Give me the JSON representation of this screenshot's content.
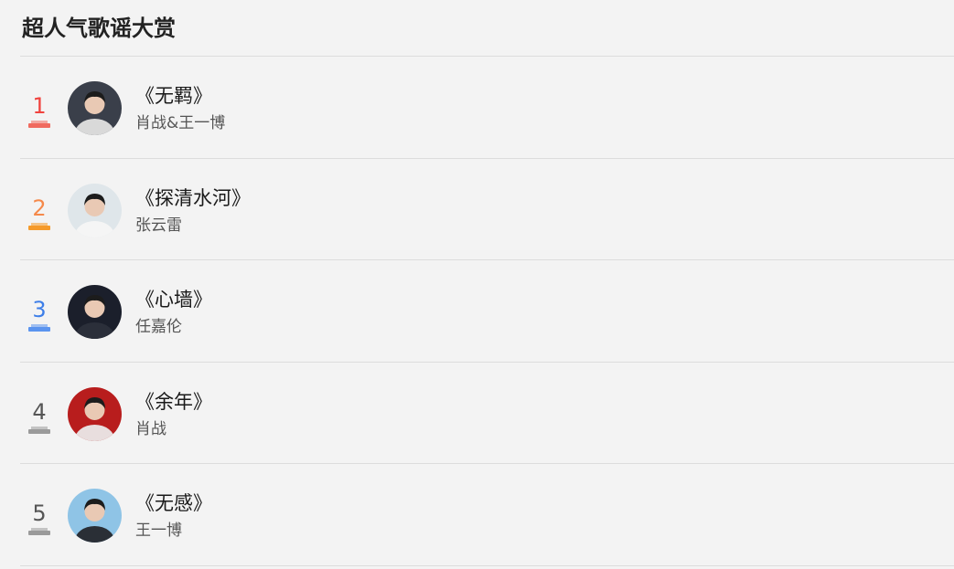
{
  "title": "超人气歌谣大赏",
  "rows": [
    {
      "rank": "1",
      "song": "《无羁》",
      "artist": "肖战&王一博",
      "rank_color": "#f0433e",
      "bar_color": "#f06a5f",
      "avatar_bg": "#3a3f4a",
      "avatar_accent": "#d9d9d9"
    },
    {
      "rank": "2",
      "song": "《探清水河》",
      "artist": "张云雷",
      "rank_color": "#f5894a",
      "bar_color": "#f59a2a",
      "avatar_bg": "#dfe6ea",
      "avatar_accent": "#f5f5f5"
    },
    {
      "rank": "3",
      "song": "《心墙》",
      "artist": "任嘉伦",
      "rank_color": "#3d7ee8",
      "bar_color": "#5b94ef",
      "avatar_bg": "#1b1f2b",
      "avatar_accent": "#2b2f3a"
    },
    {
      "rank": "4",
      "song": "《余年》",
      "artist": "肖战",
      "rank_color": "#555555",
      "bar_color": "#9a9a9a",
      "avatar_bg": "#b81d1d",
      "avatar_accent": "#e8dede"
    },
    {
      "rank": "5",
      "song": "《无感》",
      "artist": "王一博",
      "rank_color": "#555555",
      "bar_color": "#9a9a9a",
      "avatar_bg": "#8fc4e6",
      "avatar_accent": "#2a2f36"
    }
  ]
}
